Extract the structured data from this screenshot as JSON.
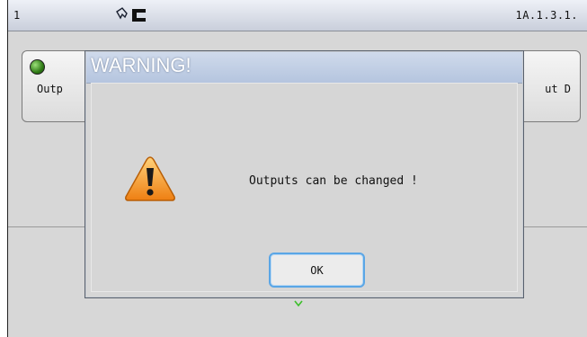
{
  "statusbar": {
    "left_text": "1",
    "right_text": "1A.1.3.1."
  },
  "card": {
    "label_left": "Outp",
    "label_right": "ut D"
  },
  "dialog": {
    "title": "WARNING!",
    "message": "Outputs can be changed !",
    "ok_label": "OK"
  },
  "icons": {
    "status": "hand-hold-icon",
    "led": "green-led-icon",
    "warning": "warning-triangle-icon",
    "marker": "green-down-arrow-icon"
  },
  "colors": {
    "accent": "#5aa6e6",
    "warning": "#f08c1a",
    "led": "#2f7b15"
  }
}
